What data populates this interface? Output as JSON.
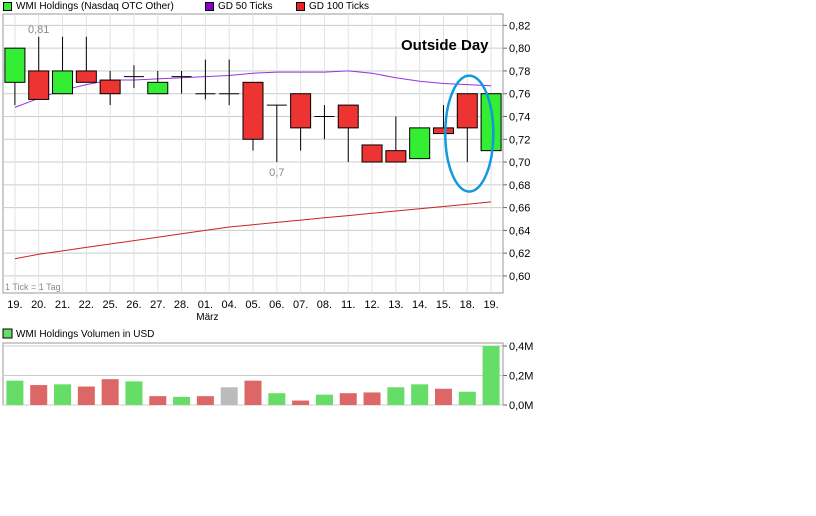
{
  "colors": {
    "up": "#33ee33",
    "down": "#ee3333",
    "neutral": "#bbbbbb",
    "vol_up": "#66dd66",
    "vol_down": "#dd6666",
    "vol_neutral": "#bbbbbb",
    "gd50": "#9933dd",
    "gd100": "#cc2222",
    "grid": "#cccccc",
    "annotation_circle": "#1199dd"
  },
  "legend": [
    {
      "label": "WMI Holdings (Nasdaq OTC Other)",
      "color": "#33ee33"
    },
    {
      "label": "GD 50 Ticks",
      "color": "#8800cc"
    },
    {
      "label": "GD 100 Ticks",
      "color": "#ee2222"
    }
  ],
  "chart_data": [
    {
      "type": "candlestick",
      "categories": [
        "19.",
        "20.",
        "21.",
        "22.",
        "25.",
        "26.",
        "27.",
        "28.",
        "01.",
        "04.",
        "05.",
        "06.",
        "07.",
        "08.",
        "11.",
        "12.",
        "13.",
        "14.",
        "15.",
        "18.",
        "19."
      ],
      "month_label": "März",
      "ohlc": [
        [
          0.77,
          0.8,
          0.75,
          0.8
        ],
        [
          0.78,
          0.81,
          0.755,
          0.755
        ],
        [
          0.76,
          0.81,
          0.76,
          0.78
        ],
        [
          0.78,
          0.81,
          0.77,
          0.77
        ],
        [
          0.772,
          0.78,
          0.75,
          0.76
        ],
        [
          0.775,
          0.785,
          0.765,
          0.775
        ],
        [
          0.76,
          0.78,
          0.76,
          0.77
        ],
        [
          0.775,
          0.78,
          0.76,
          0.775
        ],
        [
          0.76,
          0.79,
          0.755,
          0.76
        ],
        [
          0.76,
          0.79,
          0.75,
          0.76
        ],
        [
          0.77,
          0.77,
          0.71,
          0.72
        ],
        [
          0.75,
          0.75,
          0.7,
          0.75
        ],
        [
          0.76,
          0.76,
          0.71,
          0.73
        ],
        [
          0.74,
          0.75,
          0.72,
          0.74
        ],
        [
          0.75,
          0.75,
          0.7,
          0.73
        ],
        [
          0.715,
          0.715,
          0.7,
          0.7
        ],
        [
          0.71,
          0.74,
          0.7,
          0.7
        ],
        [
          0.703,
          0.73,
          0.703,
          0.73
        ],
        [
          0.73,
          0.75,
          0.725,
          0.725
        ],
        [
          0.76,
          0.76,
          0.7,
          0.73
        ],
        [
          0.71,
          0.76,
          0.71,
          0.76
        ]
      ],
      "gd50": [
        0.748,
        0.756,
        0.763,
        0.768,
        0.772,
        0.772,
        0.773,
        0.774,
        0.775,
        0.776,
        0.778,
        0.779,
        0.779,
        0.779,
        0.78,
        0.778,
        0.774,
        0.771,
        0.769,
        0.768,
        0.767
      ],
      "gd100": [
        0.615,
        0.619,
        0.622,
        0.625,
        0.628,
        0.631,
        0.634,
        0.637,
        0.64,
        0.643,
        0.645,
        0.647,
        0.649,
        0.651,
        0.653,
        0.655,
        0.657,
        0.659,
        0.661,
        0.663,
        0.665
      ],
      "ylim": [
        0.585,
        0.83
      ],
      "yticks": [
        "0,82",
        "0,80",
        "0,78",
        "0,76",
        "0,74",
        "0,72",
        "0,70",
        "0,68",
        "0,66",
        "0,64",
        "0,62",
        "0,60"
      ],
      "annotations": {
        "high": {
          "text": "0,81",
          "index": 1
        },
        "low": {
          "text": "0,7",
          "index": 11
        },
        "title": "Outside Day",
        "tick_note": "1 Tick = 1 Tag"
      }
    },
    {
      "type": "bar",
      "title": "WMI Holdings Volumen in USD",
      "values": [
        0.165,
        0.135,
        0.14,
        0.125,
        0.175,
        0.16,
        0.06,
        0.055,
        0.06,
        0.12,
        0.165,
        0.08,
        0.03,
        0.07,
        0.08,
        0.085,
        0.12,
        0.14,
        0.11,
        0.09,
        0.4
      ],
      "directions": [
        "up",
        "down",
        "up",
        "down",
        "down",
        "up",
        "down",
        "up",
        "down",
        "neutral",
        "down",
        "up",
        "down",
        "up",
        "down",
        "down",
        "up",
        "up",
        "down",
        "up",
        "up"
      ],
      "ylim": [
        0,
        0.42
      ],
      "yticks": [
        "0,4M",
        "0,2M",
        "0,0M"
      ],
      "ytick_values": [
        0.4,
        0.2,
        0.0
      ]
    }
  ]
}
